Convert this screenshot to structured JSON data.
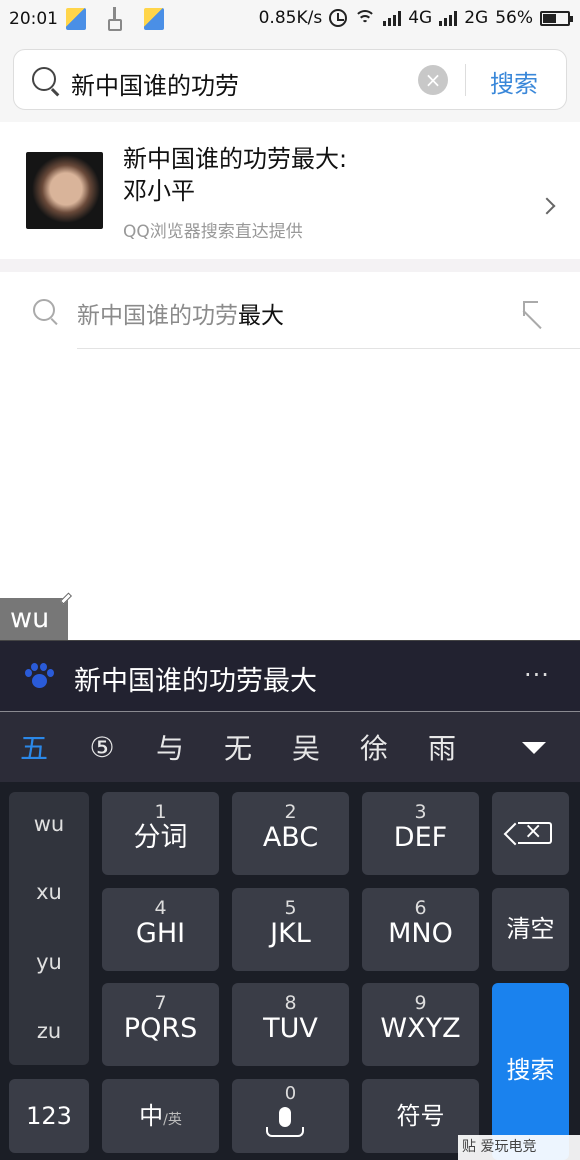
{
  "status_bar": {
    "time": "20:01",
    "speed": "0.85K/s",
    "net1": "4G",
    "net2": "2G",
    "battery": "56%"
  },
  "search": {
    "query": "新中国谁的功劳",
    "button_label": "搜索"
  },
  "answer_card": {
    "title_line1": "新中国谁的功劳最大:",
    "title_line2": "邓小平",
    "source": "QQ浏览器搜索直达提供"
  },
  "suggestion": {
    "typed": "新中国谁的功劳",
    "completion": "最大"
  },
  "ime": {
    "composing": "wu",
    "prediction": "新中国谁的功劳最大",
    "more_label": "···",
    "candidates": [
      "五",
      "⑤",
      "与",
      "无",
      "吴",
      "徐",
      "雨"
    ],
    "pinyin_options": [
      "wu",
      "xu",
      "yu",
      "zu"
    ],
    "keys": {
      "k1_num": "1",
      "k1": "分词",
      "k2_num": "2",
      "k2": "ABC",
      "k3_num": "3",
      "k3": "DEF",
      "k4_num": "4",
      "k4": "GHI",
      "k5_num": "5",
      "k5": "JKL",
      "k6_num": "6",
      "k6": "MNO",
      "k7_num": "7",
      "k7": "PQRS",
      "k8_num": "8",
      "k8": "TUV",
      "k9_num": "9",
      "k9": "WXYZ",
      "k0_num": "0",
      "clear": "清空",
      "search": "搜索",
      "k123": "123",
      "lang_main": "中",
      "lang_sub": "/英",
      "symbols": "符号"
    }
  },
  "watermark": "贴 爱玩电竞",
  "colors": {
    "accent": "#3987d9",
    "keyboard_bg": "#1b1e26",
    "key_bg": "#3a3d47",
    "search_key": "#1a82ee"
  }
}
